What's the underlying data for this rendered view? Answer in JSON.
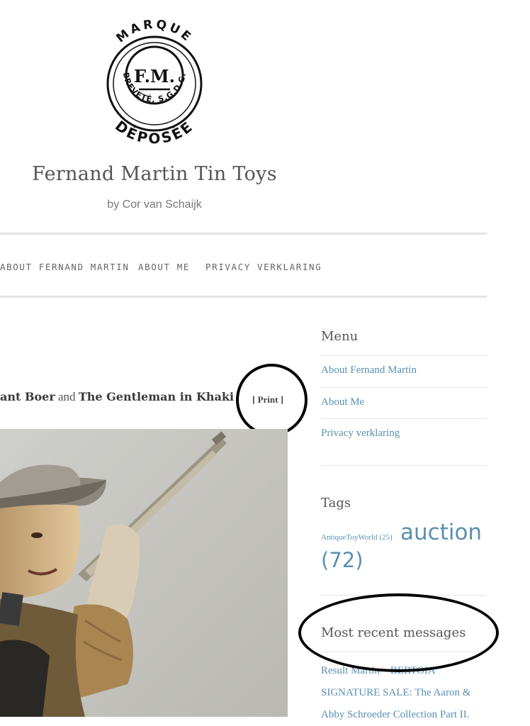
{
  "header": {
    "logo": {
      "top_text": "MARQUE",
      "center_text": "F.M.",
      "ring_text": "BREVETÉ, S.G.D.G.",
      "bottom_text": "DÉPOSÉE"
    },
    "site_title": "Fernand Martin Tin Toys",
    "byline": "by Cor van Schaijk"
  },
  "nav": {
    "items": [
      {
        "label": "About Fernand Martin"
      },
      {
        "label": "About Me"
      },
      {
        "label": "Privacy verklaring"
      }
    ]
  },
  "post": {
    "title_left_bold": "ant Boer",
    "title_connector": "and",
    "title_right_bold": "The Gentleman in Khaki",
    "print_label": "[ Print ]"
  },
  "sidebar": {
    "menu": {
      "title": "Menu",
      "links": [
        "About Fernand Martin",
        "About Me",
        "Privacy verklaring"
      ]
    },
    "tags": {
      "title": "Tags",
      "items": [
        {
          "name": "AntiqueToyWorld",
          "count": "(25)"
        },
        {
          "name": "auction",
          "count": "(72)"
        }
      ]
    },
    "recent": {
      "title": "Most recent messages",
      "first_post": "Result Martin – BERTOIA SIGNATURE SALE: The Aaron & Abby Schroeder Collection Part II."
    }
  },
  "colors": {
    "link": "#5b8fb0",
    "text": "#555555",
    "divider": "#e4e4e4",
    "annotation": "#000000"
  }
}
